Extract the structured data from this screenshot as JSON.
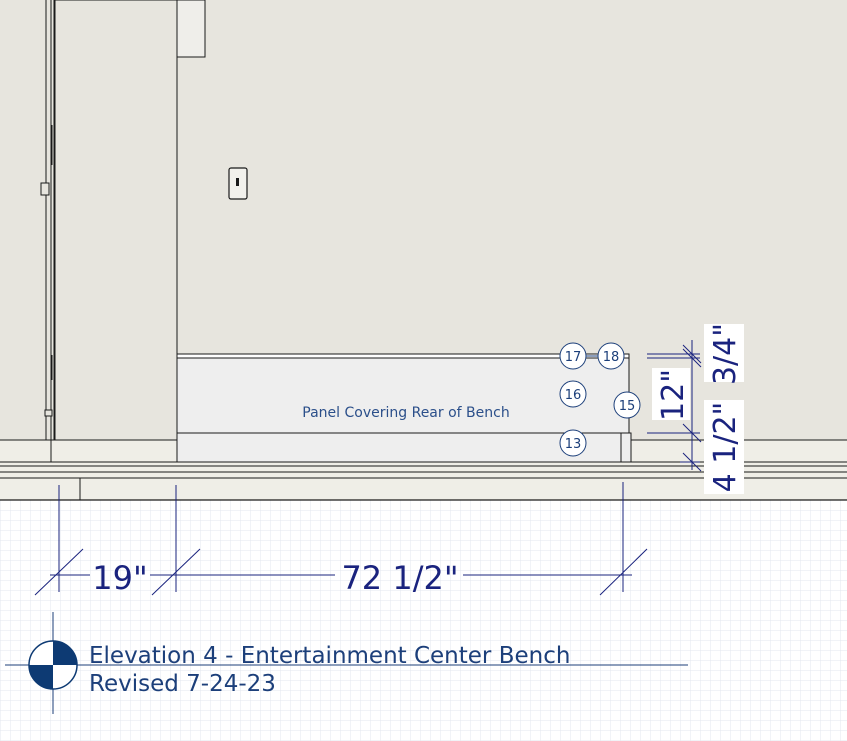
{
  "drawing": {
    "note_label": "Panel Covering Rear of Bench",
    "callouts": [
      "17",
      "18",
      "16",
      "15",
      "13"
    ],
    "dimensions": {
      "horizontal_left": "19\"",
      "horizontal_main": "72 1/2\"",
      "vertical_top": "3/4\"",
      "vertical_mid": "12\"",
      "vertical_bottom": "4 1/2\""
    },
    "title_block": {
      "title": "Elevation 4 - Entertainment Center Bench",
      "revision": "Revised 7-24-23"
    }
  },
  "colors": {
    "wall": "#e7e5de",
    "floor_band": "#efeee7",
    "panel": "#eeeeee",
    "line": "#1a1a1a",
    "annotation": "#1a237e",
    "grid": "#d6dbe6"
  }
}
